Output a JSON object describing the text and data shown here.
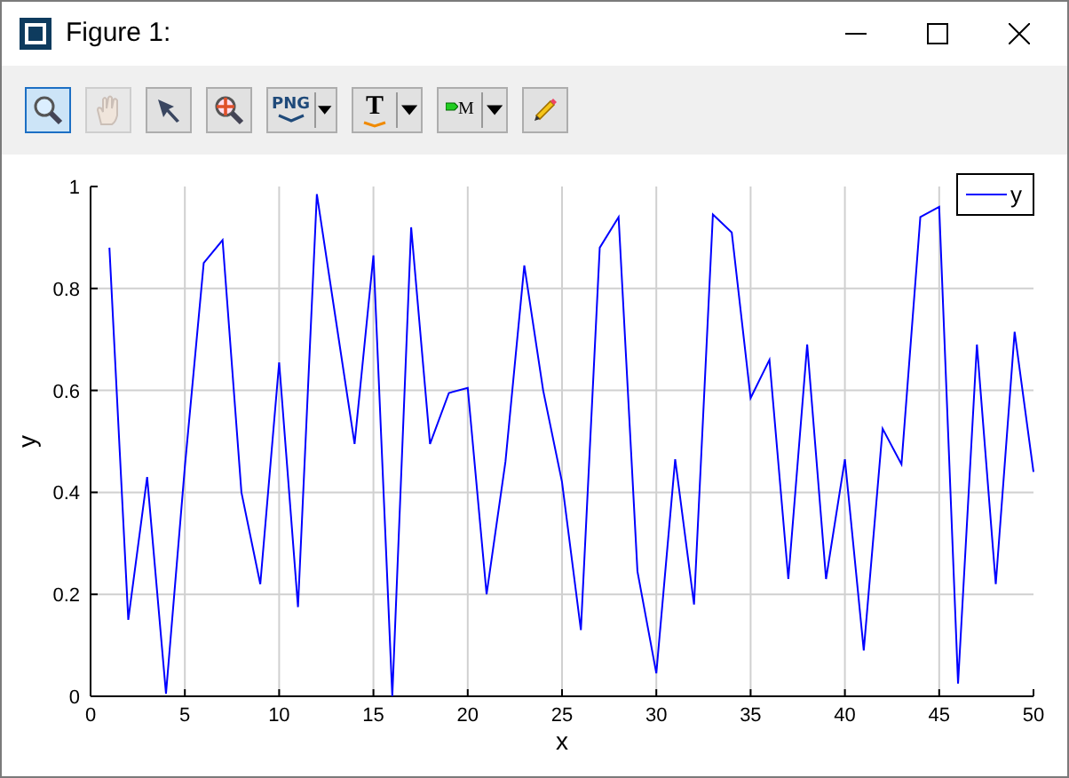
{
  "window": {
    "title": "Figure 1:"
  },
  "toolbar": [
    {
      "kind": "zoom",
      "selected": true,
      "disabled": false
    },
    {
      "kind": "pan",
      "selected": false,
      "disabled": true
    },
    {
      "kind": "pointer",
      "selected": false,
      "disabled": false
    },
    {
      "kind": "target",
      "selected": false,
      "disabled": false
    },
    {
      "kind": "export",
      "label": "PNG",
      "selected": false,
      "disabled": false
    },
    {
      "kind": "text",
      "label": "T",
      "selected": false,
      "disabled": false
    },
    {
      "kind": "marker",
      "label": "M",
      "selected": false,
      "disabled": false
    },
    {
      "kind": "pencil",
      "selected": false,
      "disabled": false
    }
  ],
  "figure": {
    "chart_data": {
      "type": "line",
      "grid": true,
      "xlabel": "x",
      "ylabel": "y",
      "xlim": [
        0,
        50
      ],
      "ylim": [
        0,
        1
      ],
      "xticks": [
        0,
        5,
        10,
        15,
        20,
        25,
        30,
        35,
        40,
        45,
        50
      ],
      "yticks": [
        {
          "value": 0,
          "label": "0"
        },
        {
          "value": 0.2,
          "label": "0.2"
        },
        {
          "value": 0.4,
          "label": "0.4"
        },
        {
          "value": 0.6,
          "label": "0.6"
        },
        {
          "value": 0.8,
          "label": "0.8"
        },
        {
          "value": 1,
          "label": "1"
        }
      ],
      "x": [
        1,
        2,
        3,
        4,
        5,
        6,
        7,
        8,
        9,
        10,
        11,
        12,
        13,
        14,
        15,
        16,
        17,
        18,
        19,
        20,
        21,
        22,
        23,
        24,
        25,
        26,
        27,
        28,
        29,
        30,
        31,
        32,
        33,
        34,
        35,
        36,
        37,
        38,
        39,
        40,
        41,
        42,
        43,
        44,
        45,
        46,
        47,
        48,
        49,
        50
      ],
      "series": [
        {
          "name": "y",
          "color": "#0000ff",
          "values": [
            0.88,
            0.15,
            0.43,
            0.005,
            0.45,
            0.85,
            0.895,
            0.4,
            0.22,
            0.655,
            0.175,
            0.985,
            0.74,
            0.495,
            0.865,
            0.0,
            0.92,
            0.495,
            0.595,
            0.605,
            0.2,
            0.46,
            0.845,
            0.6,
            0.42,
            0.13,
            0.88,
            0.94,
            0.245,
            0.045,
            0.465,
            0.18,
            0.945,
            0.91,
            0.585,
            0.66,
            0.23,
            0.69,
            0.23,
            0.465,
            0.09,
            0.525,
            0.455,
            0.94,
            0.96,
            0.025,
            0.69,
            0.22,
            0.715,
            0.44
          ]
        }
      ]
    }
  }
}
